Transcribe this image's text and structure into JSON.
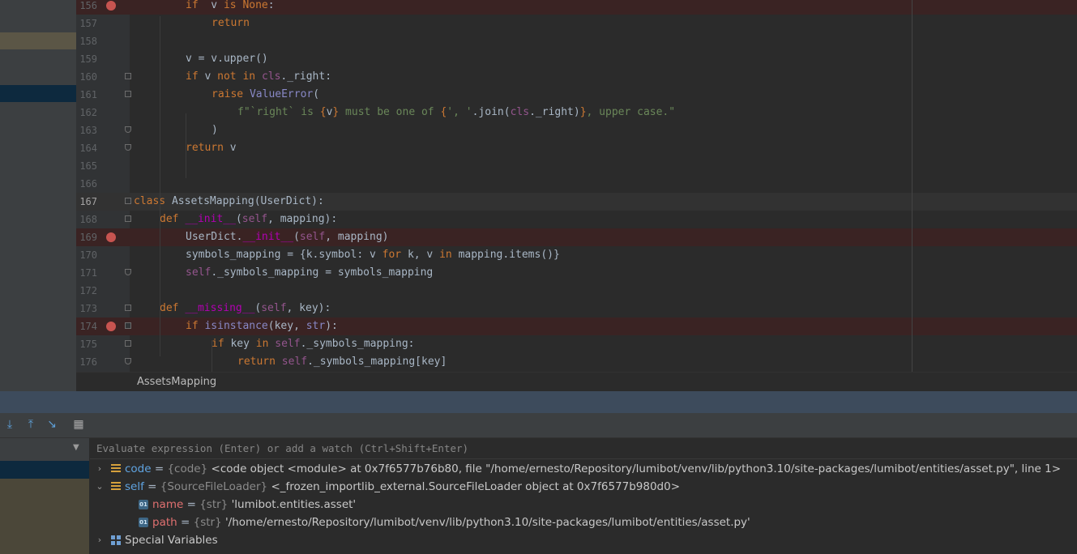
{
  "editor": {
    "lines": [
      {
        "num": "156",
        "indent": 2,
        "bp": true,
        "fold": "",
        "t": [
          [
            "kw",
            "if"
          ],
          [
            "",
            "  v "
          ],
          [
            "kw",
            "is"
          ],
          [
            "kw",
            " None"
          ],
          [
            "",
            ":"
          ]
        ]
      },
      {
        "num": "157",
        "indent": 3,
        "bp": false,
        "fold": "",
        "t": [
          [
            "kw",
            "return"
          ]
        ]
      },
      {
        "num": "158",
        "indent": 0,
        "bp": false,
        "fold": "",
        "t": []
      },
      {
        "num": "159",
        "indent": 2,
        "bp": false,
        "fold": "",
        "t": [
          [
            "",
            "v = v.upper()"
          ]
        ]
      },
      {
        "num": "160",
        "indent": 2,
        "bp": false,
        "fold": "open",
        "t": [
          [
            "kw",
            "if"
          ],
          [
            "",
            " v "
          ],
          [
            "kw",
            "not in"
          ],
          [
            "",
            " "
          ],
          [
            "sf",
            "cls"
          ],
          [
            "",
            "._right:"
          ]
        ]
      },
      {
        "num": "161",
        "indent": 3,
        "bp": false,
        "fold": "open",
        "t": [
          [
            "kw",
            "raise"
          ],
          [
            "",
            " "
          ],
          [
            "bi",
            "ValueError"
          ],
          [
            "",
            "("
          ]
        ]
      },
      {
        "num": "162",
        "indent": 4,
        "bp": false,
        "fold": "",
        "t": [
          [
            "st",
            "f\"`right` is "
          ],
          [
            "kw",
            "{"
          ],
          [
            "",
            "v"
          ],
          [
            "kw",
            "}"
          ],
          [
            "st",
            " must be one of "
          ],
          [
            "kw",
            "{"
          ],
          [
            "st",
            "', '"
          ],
          [
            "",
            ".join("
          ],
          [
            "sf",
            "cls"
          ],
          [
            "",
            "._right)"
          ],
          [
            "kw",
            "}"
          ],
          [
            "st",
            ", upper case.\""
          ]
        ]
      },
      {
        "num": "163",
        "indent": 3,
        "bp": false,
        "fold": "end",
        "t": [
          [
            "",
            ")"
          ]
        ]
      },
      {
        "num": "164",
        "indent": 2,
        "bp": false,
        "fold": "end",
        "t": [
          [
            "kw",
            "return"
          ],
          [
            "",
            " v"
          ]
        ]
      },
      {
        "num": "165",
        "indent": 0,
        "bp": false,
        "fold": "",
        "t": []
      },
      {
        "num": "166",
        "indent": 0,
        "bp": false,
        "fold": "",
        "t": []
      },
      {
        "num": "167",
        "indent": 0,
        "bp": false,
        "cur": true,
        "fold": "open",
        "t": [
          [
            "kw",
            "class"
          ],
          [
            "",
            " AssetsMapping(UserDict):"
          ]
        ]
      },
      {
        "num": "168",
        "indent": 1,
        "bp": false,
        "fold": "open",
        "t": [
          [
            "kw",
            "def"
          ],
          [
            "",
            " "
          ],
          [
            "dn",
            "__init__"
          ],
          [
            "",
            "("
          ],
          [
            "sf",
            "self"
          ],
          [
            "",
            ", mapping):"
          ]
        ]
      },
      {
        "num": "169",
        "indent": 2,
        "bp": true,
        "fold": "",
        "t": [
          [
            "",
            "UserDict."
          ],
          [
            "dn",
            "__init__"
          ],
          [
            "",
            "("
          ],
          [
            "sf",
            "self"
          ],
          [
            "",
            ", mapping)"
          ]
        ]
      },
      {
        "num": "170",
        "indent": 2,
        "bp": false,
        "fold": "",
        "t": [
          [
            "",
            "symbols_mapping = {k.symbol: v "
          ],
          [
            "kw",
            "for"
          ],
          [
            "",
            " k, v "
          ],
          [
            "kw",
            "in"
          ],
          [
            "",
            " mapping.items()}"
          ]
        ]
      },
      {
        "num": "171",
        "indent": 2,
        "bp": false,
        "fold": "end",
        "t": [
          [
            "sf",
            "self"
          ],
          [
            "",
            "._symbols_mapping = symbols_mapping"
          ]
        ]
      },
      {
        "num": "172",
        "indent": 0,
        "bp": false,
        "fold": "",
        "t": []
      },
      {
        "num": "173",
        "indent": 1,
        "bp": false,
        "fold": "open",
        "t": [
          [
            "kw",
            "def"
          ],
          [
            "",
            " "
          ],
          [
            "dn",
            "__missing__"
          ],
          [
            "",
            "("
          ],
          [
            "sf",
            "self"
          ],
          [
            "",
            ", key):"
          ]
        ]
      },
      {
        "num": "174",
        "indent": 2,
        "bp": true,
        "fold": "open",
        "t": [
          [
            "kw",
            "if"
          ],
          [
            "",
            " "
          ],
          [
            "bi",
            "isinstance"
          ],
          [
            "",
            "(key, "
          ],
          [
            "bi",
            "str"
          ],
          [
            "",
            "):"
          ]
        ]
      },
      {
        "num": "175",
        "indent": 3,
        "bp": false,
        "fold": "open",
        "t": [
          [
            "kw",
            "if"
          ],
          [
            "",
            " key "
          ],
          [
            "kw",
            "in"
          ],
          [
            "",
            " "
          ],
          [
            "sf",
            "self"
          ],
          [
            "",
            "._symbols_mapping:"
          ]
        ]
      },
      {
        "num": "176",
        "indent": 4,
        "bp": false,
        "fold": "end",
        "t": [
          [
            "kw",
            "return"
          ],
          [
            "",
            " "
          ],
          [
            "sf",
            "self"
          ],
          [
            "",
            "._symbols_mapping[key]"
          ]
        ]
      }
    ]
  },
  "breadcrumb": {
    "label": "AssetsMapping"
  },
  "toolbar": {
    "icons": [
      "step-into-my-code-icon",
      "step-out-icon",
      "run-to-cursor-icon",
      "evaluate-expression-icon"
    ]
  },
  "watch": {
    "placeholder": "Evaluate expression (Enter) or add a watch (Ctrl+Shift+Enter)"
  },
  "variables": [
    {
      "arrow": "›",
      "icon": "obj",
      "name": "code",
      "type": "{code}",
      "value": "<code object <module> at 0x7f6577b76b80, file \"/home/ernesto/Repository/lumibot/venv/lib/python3.10/site-packages/lumibot/entities/asset.py\", line 1>",
      "level": 0
    },
    {
      "arrow": "⌄",
      "icon": "obj",
      "name": "self",
      "type": "{SourceFileLoader}",
      "value": "<_frozen_importlib_external.SourceFileLoader object at 0x7f6577b980d0>",
      "level": 0
    },
    {
      "arrow": "",
      "icon": "str",
      "name": "name",
      "type": "{str}",
      "value": "'lumibot.entities.asset'",
      "level": 1
    },
    {
      "arrow": "",
      "icon": "str",
      "name": "path",
      "type": "{str}",
      "value": "'/home/ernesto/Repository/lumibot/venv/lib/python3.10/site-packages/lumibot/entities/asset.py'",
      "level": 1
    },
    {
      "arrow": "›",
      "icon": "spec",
      "name": "Special Variables",
      "type": "",
      "value": "",
      "level": 0
    }
  ]
}
